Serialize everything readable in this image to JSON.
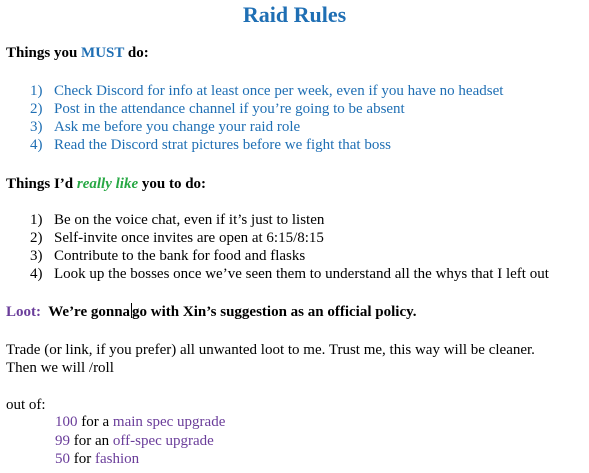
{
  "colors": {
    "blue": "#1f6fb4",
    "green": "#27a844",
    "purple": "#6a3d9a",
    "black": "#000000"
  },
  "title": "Raid Rules",
  "must_section": {
    "heading_prefix": "Things you ",
    "heading_emphasis": "MUST",
    "heading_suffix": " do:",
    "items": [
      {
        "num": "1)",
        "text": "Check Discord for info at least once per week, even if you have no headset"
      },
      {
        "num": "2)",
        "text": "Post in the attendance channel if you’re going to be absent"
      },
      {
        "num": "3)",
        "text": "Ask me before you change your raid role"
      },
      {
        "num": "4)",
        "text": "Read the Discord strat pictures before we fight that boss"
      }
    ]
  },
  "like_section": {
    "heading_prefix": "Things I’d ",
    "heading_emphasis": "really like",
    "heading_suffix": " you to do:",
    "items": [
      {
        "num": "1)",
        "text": "Be on the voice chat, even if it’s just to listen"
      },
      {
        "num": "2)",
        "text": "Self-invite once invites are open at 6:15/8:15"
      },
      {
        "num": "3)",
        "text": "Contribute to the bank for food and flasks"
      },
      {
        "num": "4)",
        "text": "Look up the bosses once we’ve seen them to understand all the whys that I left out"
      }
    ]
  },
  "loot": {
    "label": "Loot:",
    "text_before_cursor": "We’re gonna",
    "text_after_cursor": "go with Xin’s suggestion as an official policy.",
    "paragraph_line1": "Trade (or link, if you prefer) all unwanted loot to me. Trust me, this way will be cleaner.",
    "paragraph_line2": "Then we will /roll",
    "out_of": "out of:",
    "scale": [
      {
        "number": "100",
        "connector": "for a",
        "category": "main spec upgrade"
      },
      {
        "number": "99",
        "connector": "for an",
        "category": "off-spec upgrade"
      },
      {
        "number": "50",
        "connector": "for",
        "category": "fashion"
      }
    ]
  }
}
